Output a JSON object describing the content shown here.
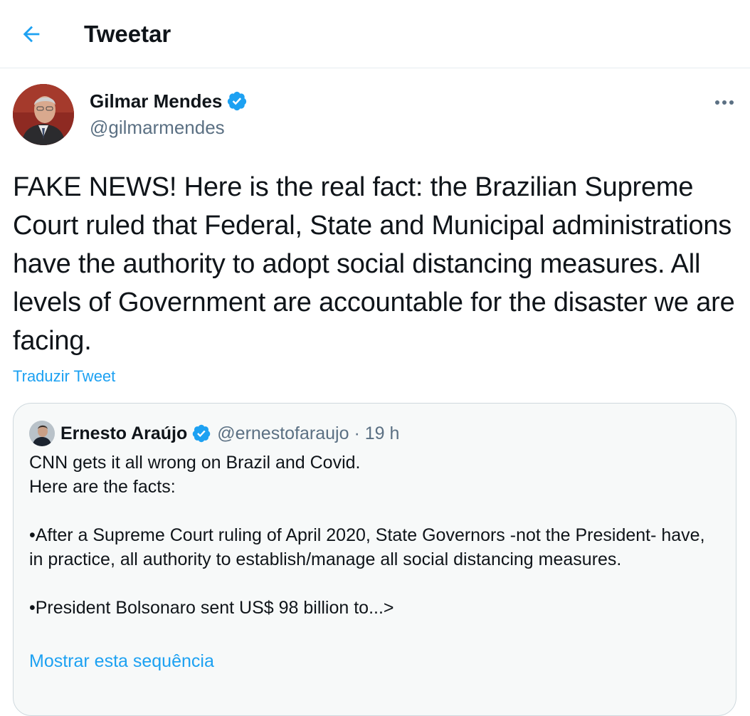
{
  "header": {
    "back_icon": "arrow-left-icon",
    "title": "Tweetar"
  },
  "tweet": {
    "author": {
      "name": "Gilmar Mendes",
      "handle": "@gilmarmendes",
      "verified": true
    },
    "text": "FAKE NEWS! Here is the real fact: the Brazilian Supreme Court ruled that Federal, State and Municipal administrations have the authority to adopt social distancing measures. All levels of Government are accountable for the disaster we are facing.",
    "translate_label": "Traduzir Tweet"
  },
  "quoted_tweet": {
    "author": {
      "name": "Ernesto Araújo",
      "handle": "@ernestofaraujo",
      "verified": true
    },
    "time": "19 h",
    "text": "CNN gets it all wrong on Brazil and Covid.\nHere are the facts:\n\n•After a Supreme Court ruling of April 2020, State Governors -not the President- have, in practice, all authority to establish/manage all social distancing measures.\n\n•President Bolsonaro sent US$ 98 billion to...>",
    "show_thread_label": "Mostrar esta sequência"
  },
  "colors": {
    "accent": "#1da1f2",
    "secondary_text": "#5b7083",
    "border": "#e6ecf0"
  }
}
